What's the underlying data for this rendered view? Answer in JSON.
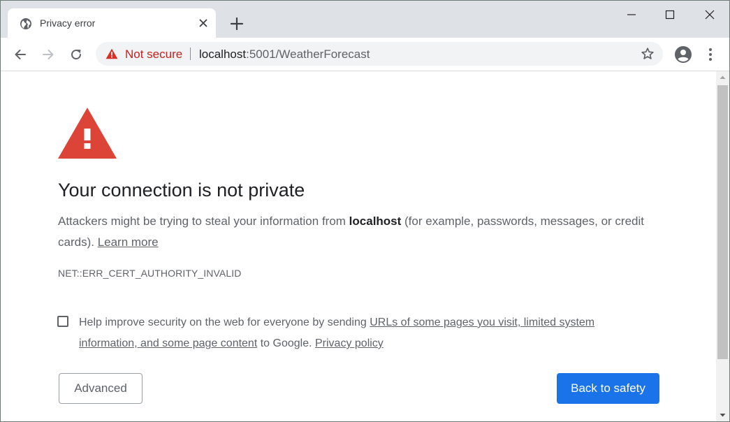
{
  "tab": {
    "title": "Privacy error",
    "favicon": "globe-icon"
  },
  "toolbar": {
    "security_label": "Not secure",
    "url_host": "localhost",
    "url_rest": ":5001/WeatherForecast"
  },
  "interstitial": {
    "heading": "Your connection is not private",
    "explanation_prefix": "Attackers might be trying to steal your information from ",
    "explanation_host": "localhost",
    "explanation_suffix": " (for example, passwords, messages, or credit cards). ",
    "learn_more": "Learn more",
    "error_code": "NET::ERR_CERT_AUTHORITY_INVALID",
    "optin_prefix": "Help improve security on the web for everyone by sending ",
    "optin_link": "URLs of some pages you visit, limited system information, and some page content",
    "optin_middle": " to Google. ",
    "privacy_link": "Privacy policy",
    "checkbox_checked": false,
    "advanced_label": "Advanced",
    "back_label": "Back to safety"
  },
  "colors": {
    "accent": "#1a73e8",
    "warning": "#d93025",
    "not_secure": "#c5221f",
    "tabstrip": "#dee1e6"
  }
}
